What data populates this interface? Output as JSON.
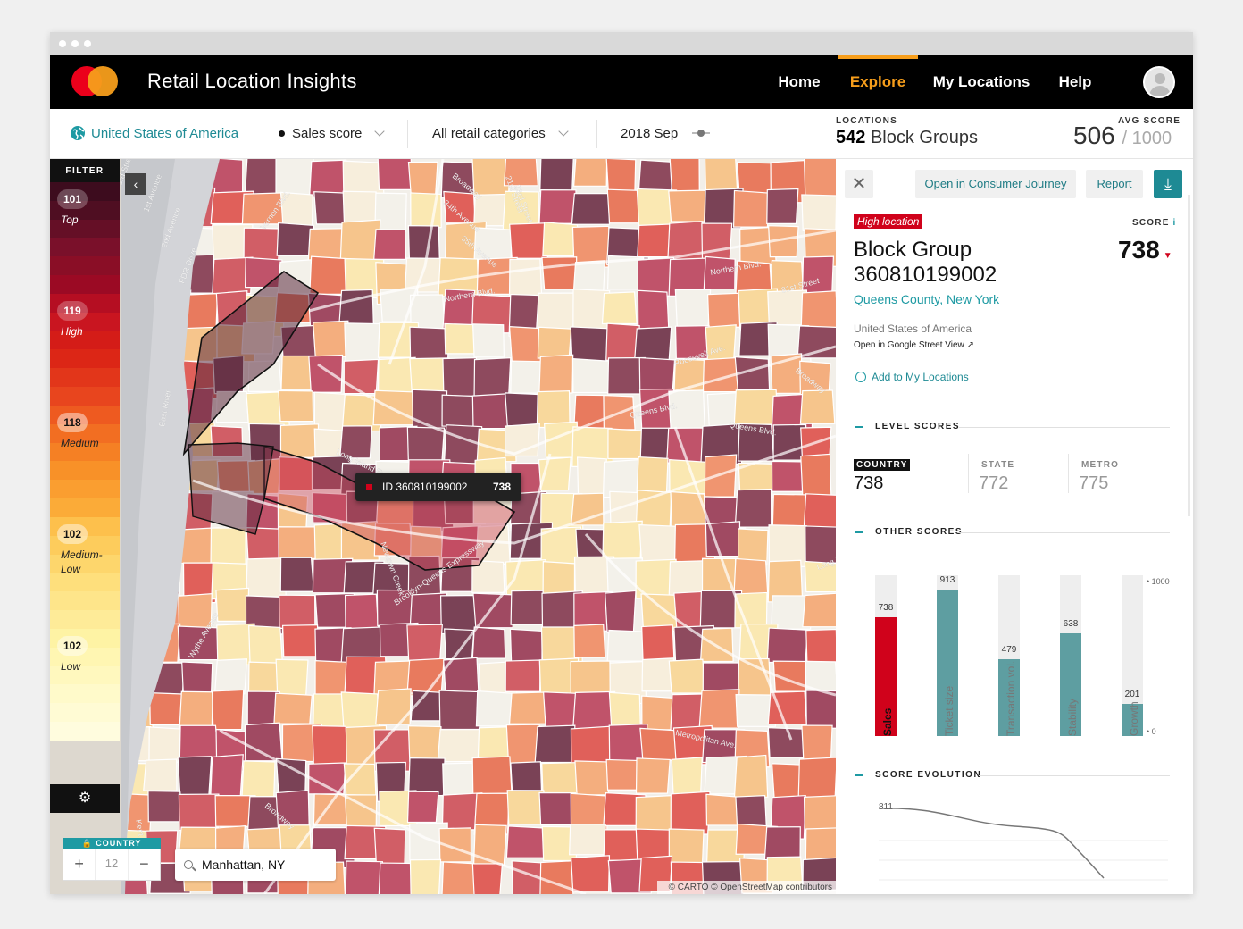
{
  "app": {
    "title": "Retail Location Insights"
  },
  "nav": {
    "home": "Home",
    "explore": "Explore",
    "my_locations": "My Locations",
    "help": "Help"
  },
  "subbar": {
    "country": "United States of America",
    "score_type": "Sales score",
    "categories": "All retail categories",
    "date": "2018 Sep",
    "locations_label": "LOCATIONS",
    "locations_count": "542",
    "locations_unit": "Block Groups",
    "avg_label": "AVG SCORE",
    "avg_value": "506",
    "avg_max": "/ 1000"
  },
  "filter": {
    "title": "FILTER",
    "levels": [
      {
        "count": "101",
        "name": "Top"
      },
      {
        "count": "119",
        "name": "High"
      },
      {
        "count": "118",
        "name": "Medium"
      },
      {
        "count": "102",
        "name": "Medium-\nLow"
      },
      {
        "count": "102",
        "name": "Low"
      }
    ]
  },
  "map": {
    "zoom_head": "COUNTRY",
    "zoom_plus": "+",
    "zoom_level": "12",
    "zoom_minus": "−",
    "search_value": "Manhattan, NY",
    "attribution": "© CARTO © OpenStreetMap contributors",
    "tooltip_id": "ID 360810199002",
    "tooltip_value": "738",
    "streets": [
      "Northern Blvd.",
      "Long Island Expressway",
      "Queens Blvd.",
      "Roosevelt Ave.",
      "Broadway",
      "Metropolitan Ave.",
      "Brooklyn-Queens Expressway",
      "Vernon Blvd.",
      "34th Avenue",
      "35th Avenue",
      "East River",
      "Kent Avenue",
      "Wythe Avenue",
      "Broadway",
      "Newtown Creek",
      "Long Island",
      "81st Street",
      "1st Avenue",
      "FDR Drive",
      "2nd Avenue",
      "3rd Street",
      "21st Street",
      "23rd Street",
      "Northern Blvd.",
      "Broadway",
      "Queens Blvd."
    ]
  },
  "panel": {
    "open_journey": "Open in Consumer Journey",
    "report": "Report",
    "tag": "High location",
    "score_label": "SCORE",
    "score_value": "738",
    "title_line1": "Block Group",
    "title_line2": "360810199002",
    "county": "Queens County, New York",
    "country": "United States of America",
    "street_view": "Open in Google Street View ↗",
    "add_location": "Add to My Locations",
    "level_scores_title": "LEVEL SCORES",
    "level_scores": [
      {
        "label": "COUNTRY",
        "value": "738"
      },
      {
        "label": "STATE",
        "value": "772"
      },
      {
        "label": "METRO",
        "value": "775"
      }
    ],
    "other_scores_title": "OTHER SCORES",
    "other_scores": [
      {
        "label": "Sales",
        "value": 738
      },
      {
        "label": "Ticket size",
        "value": 913
      },
      {
        "label": "Transaction vol.",
        "value": 479
      },
      {
        "label": "Stability",
        "value": 638
      },
      {
        "label": "Growth",
        "value": 201
      }
    ],
    "axis_max": "1000",
    "axis_min": "0",
    "evolution_title": "SCORE EVOLUTION",
    "evolution_start": "811"
  },
  "colors": {
    "accent": "#f79e1b",
    "teal": "#1e9aa3",
    "red": "#d0021b",
    "bar": "#5e9ea1"
  }
}
